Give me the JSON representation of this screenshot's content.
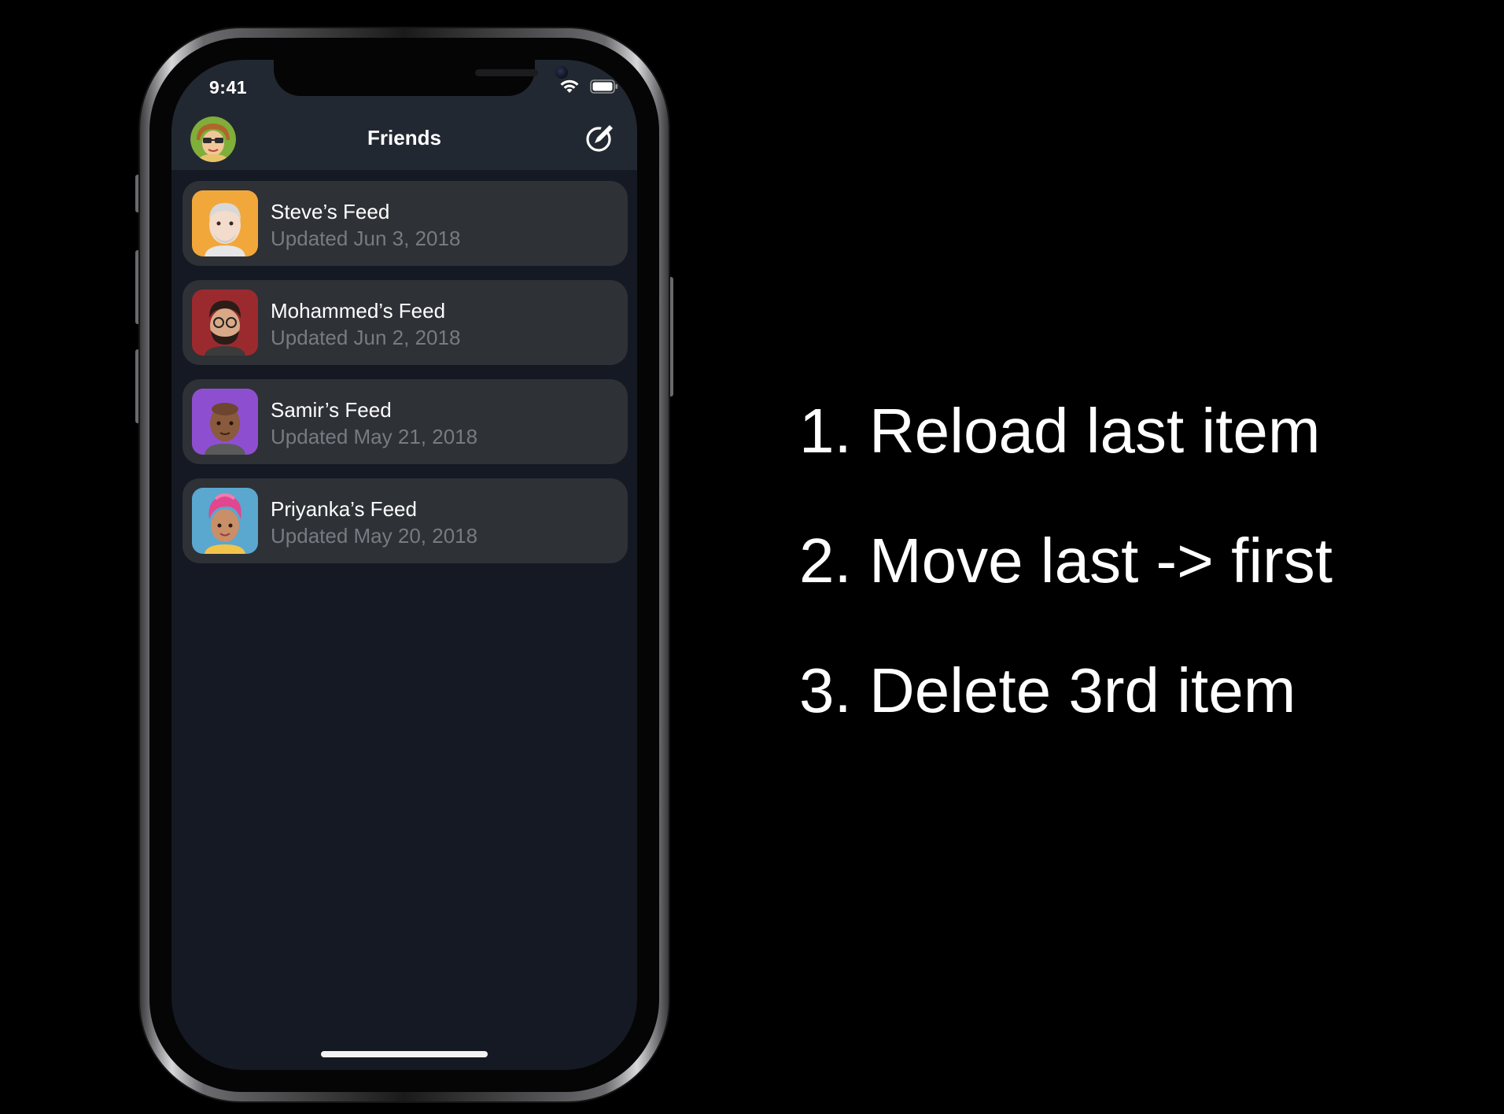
{
  "status_bar": {
    "time": "9:41",
    "wifi_icon": "wifi-icon",
    "battery_icon": "battery-full-icon"
  },
  "nav_bar": {
    "title": "Friends",
    "avatar_icon": "memoji-avatar",
    "compose_icon": "compose-icon"
  },
  "feeds": [
    {
      "title": "Steve’s Feed",
      "subtitle": "Updated Jun 3, 2018",
      "avatar_color": "#f2a73b",
      "avatar_icon": "memoji-avatar"
    },
    {
      "title": "Mohammed’s Feed",
      "subtitle": "Updated Jun 2, 2018",
      "avatar_color": "#9b2a2f",
      "avatar_icon": "memoji-avatar"
    },
    {
      "title": "Samir’s Feed",
      "subtitle": "Updated May 21, 2018",
      "avatar_color": "#8d4fd0",
      "avatar_icon": "memoji-avatar"
    },
    {
      "title": "Priyanka’s Feed",
      "subtitle": "Updated May 20, 2018",
      "avatar_color": "#5aa7cf",
      "avatar_icon": "memoji-avatar"
    }
  ],
  "steps": [
    "1. Reload last item",
    "2. Move last -> first",
    "3. Delete 3rd item"
  ],
  "colors": {
    "slide_background": "#000000",
    "screen_background": "#141923",
    "bar_background": "#222831",
    "card_background": "#2e3136",
    "title_text": "#ffffff",
    "subtitle_text": "#777b82"
  }
}
